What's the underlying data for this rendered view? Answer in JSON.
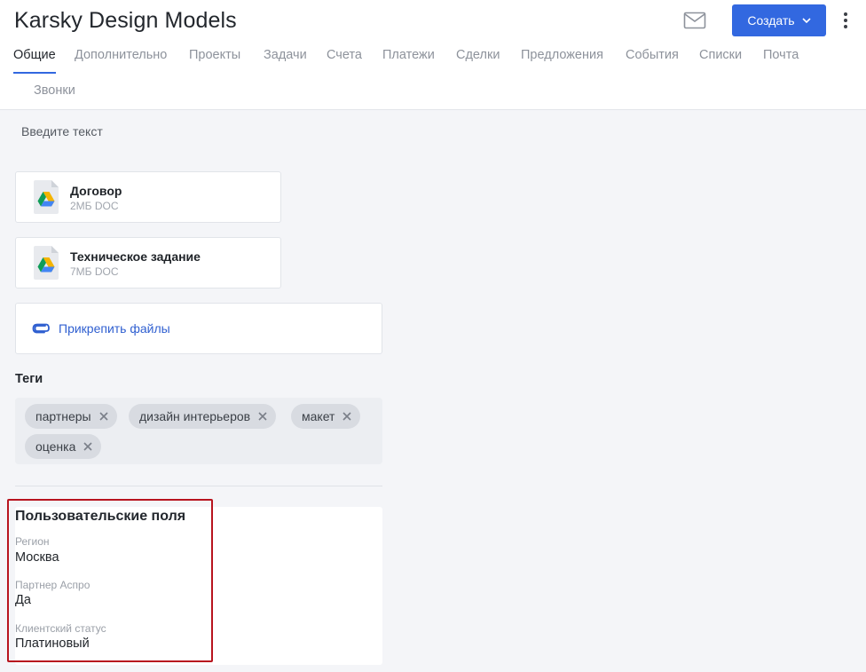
{
  "header": {
    "title": "Karsky Design Models",
    "create_label": "Создать",
    "icons": {
      "mail": "mail-icon",
      "more": "more-vertical-icon",
      "chevron": "chevron-down-icon"
    },
    "accent_color": "#3268e0"
  },
  "tabs": [
    {
      "label": "Общие",
      "active": true
    },
    {
      "label": "Дополнительно"
    },
    {
      "label": "Проекты"
    },
    {
      "label": "Задачи"
    },
    {
      "label": "Счета"
    },
    {
      "label": "Платежи"
    },
    {
      "label": "Сделки"
    },
    {
      "label": "Предложения"
    },
    {
      "label": "События"
    },
    {
      "label": "Списки"
    },
    {
      "label": "Почта"
    },
    {
      "label": "Звонки"
    }
  ],
  "description": {
    "placeholder": "Введите текст"
  },
  "files": [
    {
      "name": "Договор",
      "meta": "2МБ DOC",
      "icon": "google-drive-icon"
    },
    {
      "name": "Техническое задание",
      "meta": "7МБ DOC",
      "icon": "google-drive-icon"
    }
  ],
  "attach": {
    "label": "Прикрепить файлы",
    "icon": "paperclip-icon"
  },
  "tags": {
    "title": "Теги",
    "items": [
      "партнеры",
      "дизайн интерьеров",
      "макет",
      "оценка"
    ]
  },
  "custom_fields": {
    "title": "Пользовательские поля",
    "fields": [
      {
        "label": "Регион",
        "value": "Москва"
      },
      {
        "label": "Партнер Аспро",
        "value": "Да"
      },
      {
        "label": "Клиентский статус",
        "value": "Платиновый"
      }
    ],
    "highlight_color": "#b8141e"
  }
}
